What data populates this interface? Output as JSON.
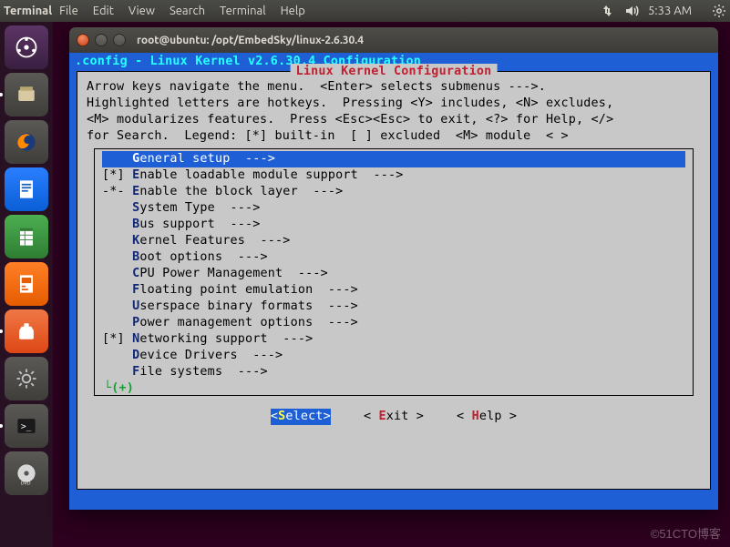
{
  "menubar": {
    "app_name": "Terminal",
    "items": [
      "File",
      "Edit",
      "View",
      "Search",
      "Terminal",
      "Help"
    ],
    "time": "5:33 AM"
  },
  "terminal": {
    "title": "root@ubuntu: /opt/EmbedSky/linux-2.6.30.4"
  },
  "menuconfig": {
    "window_title": ".config - Linux Kernel v2.6.30.4 Configuration",
    "box_title": "Linux Kernel Configuration",
    "help_lines": [
      "Arrow keys navigate the menu.  <Enter> selects submenus --->.",
      "Highlighted letters are hotkeys.  Pressing <Y> includes, <N> excludes,",
      "<M> modularizes features.  Press <Esc><Esc> to exit, <?> for Help, </>",
      "for Search.  Legend: [*] built-in  [ ] excluded  <M> module  < >"
    ],
    "items": [
      {
        "prefix": "    ",
        "hot": "G",
        "rest": "eneral setup  --->",
        "selected": true
      },
      {
        "prefix": "[*] ",
        "hot": "E",
        "rest": "nable loadable module support  --->"
      },
      {
        "prefix": "-*- ",
        "hot": "E",
        "rest": "nable the block layer  --->"
      },
      {
        "prefix": "    ",
        "hot": "S",
        "rest": "ystem Type  --->"
      },
      {
        "prefix": "    ",
        "hot": "B",
        "rest": "us support  --->"
      },
      {
        "prefix": "    ",
        "hot": "K",
        "rest": "ernel Features  --->"
      },
      {
        "prefix": "    ",
        "hot": "B",
        "rest": "oot options  --->"
      },
      {
        "prefix": "    ",
        "hot": "C",
        "rest": "PU Power Management  --->"
      },
      {
        "prefix": "    ",
        "hot": "F",
        "rest": "loating point emulation  --->"
      },
      {
        "prefix": "    ",
        "hot": "U",
        "rest": "serspace binary formats  --->"
      },
      {
        "prefix": "    ",
        "hot": "P",
        "rest": "ower management options  --->"
      },
      {
        "prefix": "[*] ",
        "hot": "N",
        "rest": "etworking support  --->"
      },
      {
        "prefix": "    ",
        "hot": "D",
        "rest": "evice Drivers  --->"
      },
      {
        "prefix": "    ",
        "hot": "F",
        "rest": "ile systems  --->"
      }
    ],
    "more_indicator": "└(+)",
    "buttons": [
      {
        "label": "Select",
        "hot": "S",
        "selected": true
      },
      {
        "label": "Exit",
        "hot": "E"
      },
      {
        "label": "Help",
        "hot": "H"
      }
    ]
  },
  "watermark": "©51CTO博客"
}
